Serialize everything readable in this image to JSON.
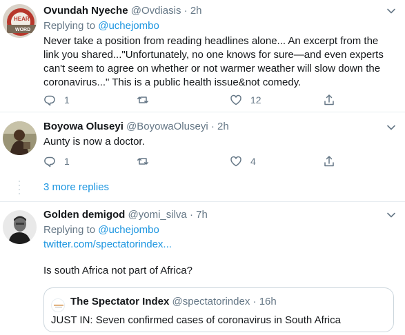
{
  "tweets": [
    {
      "name": "Ovundah Nyeche",
      "handle": "@Ovdiasis",
      "dot": "·",
      "time": "2h",
      "replying_prefix": "Replying to",
      "replying_to": "@uchejombo",
      "text_lines": [
        "Never take a position from reading headlines alone... An excerpt from the",
        "link you shared...\"Unfortunately, no one knows for sure—and even experts",
        "can't seem to agree on whether or not warmer weather will slow down the",
        "coronavirus...\" This is a public health issue&not comedy."
      ],
      "reply_count": "1",
      "retweet_count": "",
      "like_count": "12"
    },
    {
      "name": "Boyowa Oluseyi",
      "handle": "@BoyowaOluseyi",
      "dot": "·",
      "time": "2h",
      "text_lines": [
        "Aunty is now a doctor."
      ],
      "reply_count": "1",
      "retweet_count": "",
      "like_count": "4"
    },
    {
      "name": "Golden demigod",
      "handle": "@yomi_silva",
      "dot": "·",
      "time": "7h",
      "replying_prefix": "Replying to",
      "replying_to": "@uchejombo",
      "link_text": "twitter.com/spectatorindex...",
      "text_lines": [
        "Is south Africa not part of Africa?"
      ]
    }
  ],
  "more_replies": "3 more replies",
  "quote": {
    "name": "The Spectator Index",
    "handle": "@spectatorindex",
    "dot": "·",
    "time": "16h",
    "text": "JUST IN: Seven confirmed cases of coronavirus in South Africa"
  },
  "colors": {
    "text": "#14171a",
    "muted": "#657786",
    "link": "#1b95e0",
    "divider": "#e6ecf0"
  },
  "icons": [
    "reply-icon",
    "retweet-icon",
    "like-icon",
    "share-icon",
    "chevron-down-icon"
  ]
}
